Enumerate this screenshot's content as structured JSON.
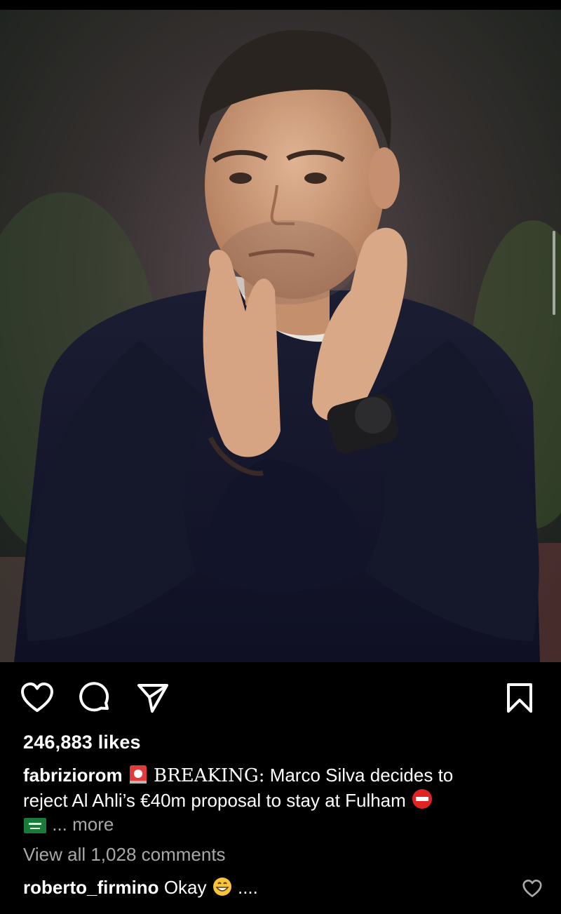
{
  "post": {
    "image_alt": "Man in navy sweater applauding",
    "likes": "246,883 likes",
    "caption": {
      "username": "fabriziorom",
      "breaking": "BREAKING:",
      "text_line1": " Marco Silva decides to",
      "text_line2": "reject Al Ahli’s €40m proposal to stay at Fulham",
      "more": "... more"
    },
    "view_comments": "View all 1,028 comments",
    "comment": {
      "username": "roberto_firmino",
      "text": "Okay",
      "suffix": "...."
    }
  },
  "icons": [
    "heart-icon",
    "comment-icon",
    "share-icon",
    "bookmark-icon",
    "siren-emoji",
    "no-entry-emoji",
    "saudi-flag-emoji",
    "grin-emoji",
    "comment-heart-icon"
  ],
  "colors": {
    "background": "#000000",
    "text": "#ffffff",
    "muted": "#a8a8a8",
    "siren_red": "#e23b3b",
    "no_entry_red": "#e02424",
    "flag_green": "#1a7a3a"
  }
}
